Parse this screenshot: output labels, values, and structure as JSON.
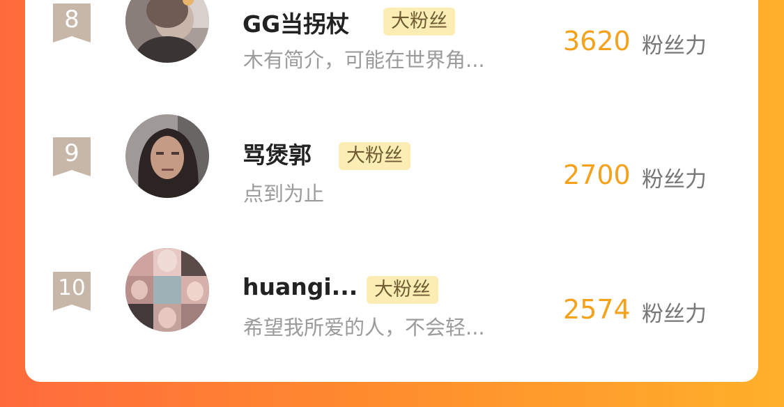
{
  "rankings": [
    {
      "rank": "8",
      "name": "GG当拐杖",
      "badge": "大粉丝",
      "bio": "木有简介，可能在世界角...",
      "score": "3620",
      "score_label": "粉丝力"
    },
    {
      "rank": "9",
      "name": "骂煲郭",
      "badge": "大粉丝",
      "bio": "点到为止",
      "score": "2700",
      "score_label": "粉丝力"
    },
    {
      "rank": "10",
      "name": "huangi...",
      "badge": "大粉丝",
      "bio": "希望我所爱的人，不会轻...",
      "score": "2574",
      "score_label": "粉丝力"
    }
  ],
  "colors": {
    "score": "#f4a11b",
    "badge_bg": "#fbedb3",
    "rank_bg": "#c7b7a9"
  }
}
